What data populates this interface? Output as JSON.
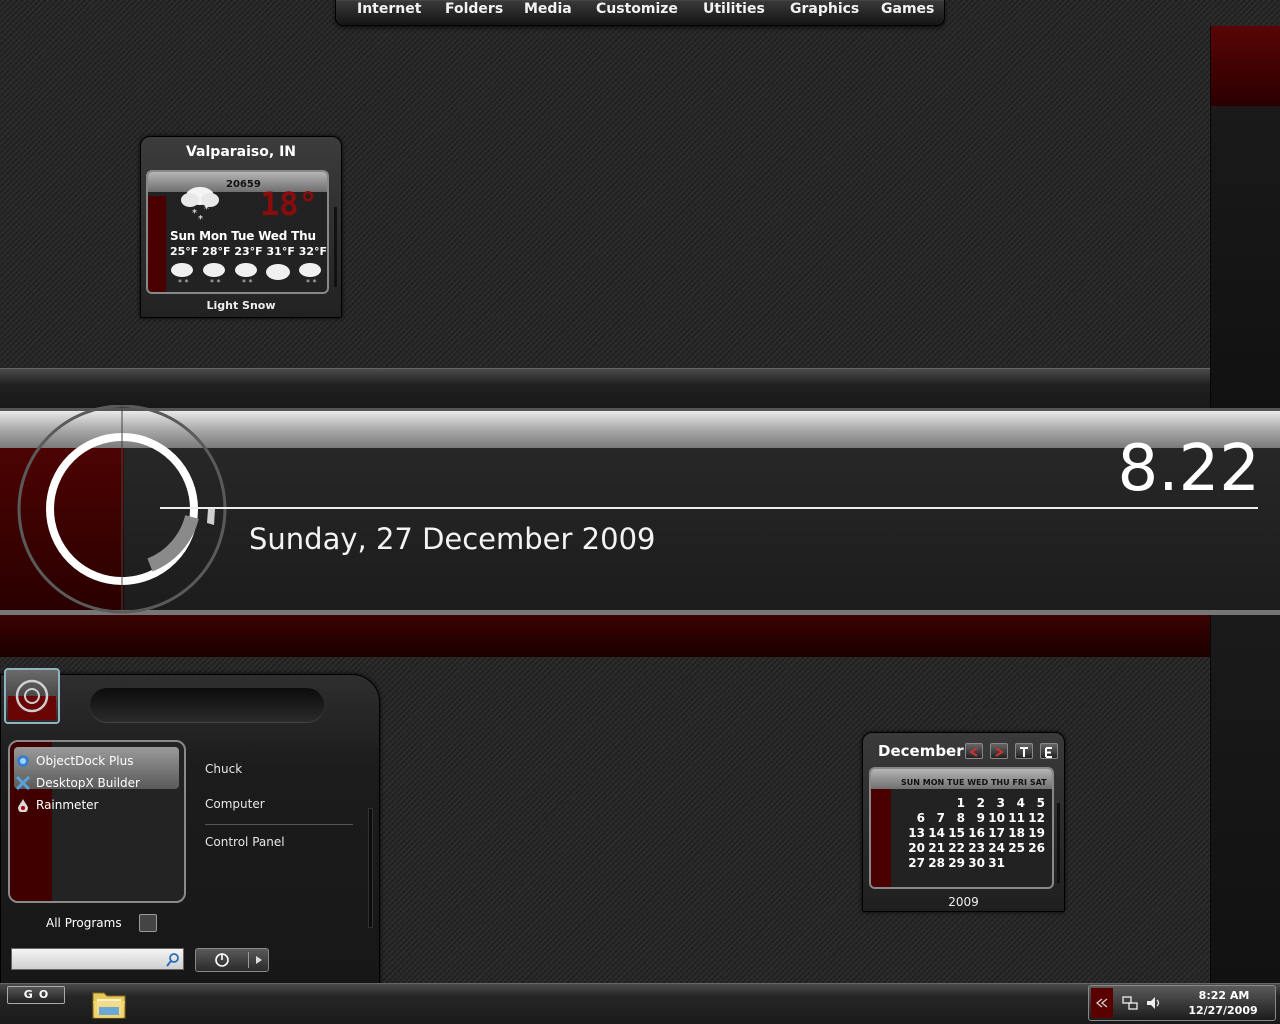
{
  "menu": {
    "items": [
      {
        "label": "Internet"
      },
      {
        "label": "Folders"
      },
      {
        "label": "Media"
      },
      {
        "label": "Customize"
      },
      {
        "label": "Utilities"
      },
      {
        "label": "Graphics"
      },
      {
        "label": "Games"
      }
    ]
  },
  "weather": {
    "location": "Valparaiso, IN",
    "code": "20659",
    "current_temp": "18°",
    "days": [
      "Sun",
      "Mon",
      "Tue",
      "Wed",
      "Thu"
    ],
    "temps": [
      "25°F",
      "28°F",
      "23°F",
      "31°F",
      "32°F"
    ],
    "condition": "Light Snow"
  },
  "clock": {
    "time": "8.22",
    "date": "Sunday, 27 December 2009"
  },
  "start_menu": {
    "programs": [
      {
        "label": "ObjectDock Plus",
        "icon": "objectdock-icon"
      },
      {
        "label": "DesktopX Builder",
        "icon": "desktopx-icon"
      },
      {
        "label": "Rainmeter",
        "icon": "rainmeter-icon"
      }
    ],
    "links": [
      {
        "label": "Chuck"
      },
      {
        "label": "Computer"
      },
      {
        "label": "Control Panel"
      }
    ],
    "all_programs": "All Programs",
    "search_value": ""
  },
  "calendar": {
    "month": "December",
    "year": "2009",
    "weekdays": [
      "SUN",
      "MON",
      "TUE",
      "WED",
      "THU",
      "FRI",
      "SAT"
    ],
    "weeks": [
      [
        "",
        "",
        "1",
        "2",
        "3",
        "4",
        "5"
      ],
      [
        "6",
        "7",
        "8",
        "9",
        "10",
        "11",
        "12"
      ],
      [
        "13",
        "14",
        "15",
        "16",
        "17",
        "18",
        "19"
      ],
      [
        "20",
        "21",
        "22",
        "23",
        "24",
        "25",
        "26"
      ],
      [
        "27",
        "28",
        "29",
        "30",
        "31",
        "",
        ""
      ]
    ],
    "buttons": [
      "prev-icon",
      "next-icon",
      "today-icon",
      "edit-icon"
    ]
  },
  "taskbar": {
    "go_label": "GO",
    "tray_time": "8:22 AM",
    "tray_date": "12/27/2009"
  },
  "colors": {
    "accent_red": "#4a0000",
    "temp_red": "#8a0c0c",
    "chrome_light": "#e8e8e8"
  }
}
